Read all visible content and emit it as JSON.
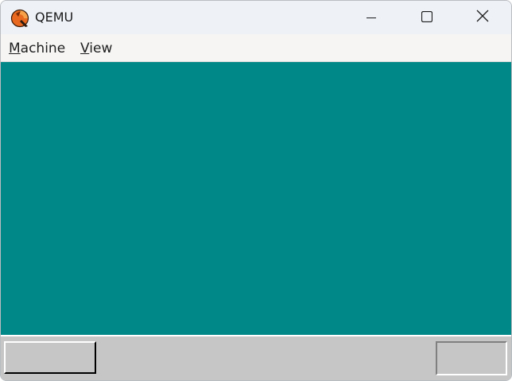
{
  "window": {
    "title": "QEMU",
    "icon": "qemu-logo-icon",
    "controls": [
      "minimize-icon",
      "maximize-icon",
      "close-icon"
    ]
  },
  "menubar": {
    "items": [
      {
        "mnemonic": "M",
        "rest": "achine"
      },
      {
        "mnemonic": "V",
        "rest": "iew"
      }
    ]
  },
  "screen": {
    "background": "#008787"
  },
  "taskbar": {
    "background": "#c6c6c6",
    "start_button_label": "",
    "tray_text": ""
  }
}
